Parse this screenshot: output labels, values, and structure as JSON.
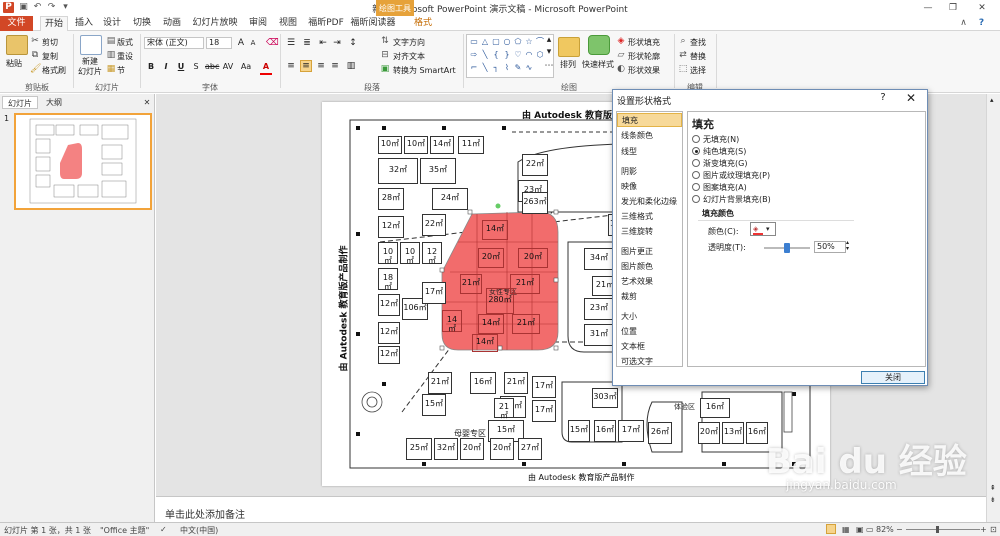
{
  "window": {
    "title": "新建 Microsoft PowerPoint 演示文稿 - Microsoft PowerPoint",
    "contextual_tab_group": "绘图工具",
    "accent": "#d24726",
    "contextual_color": "#e6a23a"
  },
  "tabs": [
    "文件",
    "开始",
    "插入",
    "设计",
    "切换",
    "动画",
    "幻灯片放映",
    "审阅",
    "视图",
    "福昕PDF",
    "福昕阅读器",
    "格式"
  ],
  "ribbon": {
    "clipboard": {
      "label": "剪贴板",
      "paste": "粘贴",
      "cut": "剪切",
      "copy": "复制",
      "format_painter": "格式刷"
    },
    "slides": {
      "label": "幻灯片",
      "new_slide": "新建\n幻灯片",
      "layout": "版式",
      "reset": "重设",
      "section": "节"
    },
    "font": {
      "label": "字体",
      "font_name": "宋体 (正文)",
      "font_size": "18"
    },
    "paragraph": {
      "label": "段落",
      "text_direction": "文字方向",
      "align_text": "对齐文本",
      "smartart": "转换为 SmartArt"
    },
    "drawing": {
      "label": "绘图",
      "arrange": "排列",
      "quick_styles": "快速样式",
      "shape_fill": "形状填充",
      "shape_outline": "形状轮廓",
      "shape_effects": "形状效果"
    },
    "editing": {
      "label": "编辑",
      "find": "查找",
      "replace": "替换",
      "select": "选择"
    }
  },
  "left_panel": {
    "tabs": [
      "幻灯片",
      "大纲"
    ],
    "slide_number": "1"
  },
  "slide": {
    "top_label": "由 Autodesk 教育版产品制作",
    "side_label": "由 Autodesk 教育版产品制作",
    "bottom_label": "由 Autodesk 教育版产品制作",
    "highlight_color": "#f26c6c",
    "zone_labels": [
      "母婴专区",
      "女性专区",
      "体验区"
    ],
    "cells": [
      "10㎡",
      "10㎡",
      "14㎡",
      "11㎡",
      "32㎡",
      "35㎡",
      "22㎡",
      "28㎡",
      "24㎡",
      "23㎡",
      "12㎡",
      "22㎡",
      "14㎡",
      "34㎡",
      "10㎡",
      "10㎡",
      "12㎡",
      "20㎡",
      "20㎡",
      "21㎡",
      "18㎡",
      "21㎡",
      "21㎡",
      "12㎡",
      "106㎡",
      "280㎡",
      "23㎡",
      "17㎡",
      "12㎡",
      "14㎡",
      "14㎡",
      "21㎡",
      "31㎡",
      "12㎡",
      "14㎡",
      "21㎡",
      "16㎡",
      "21㎡",
      "17㎡",
      "15㎡",
      "15㎡",
      "17㎡",
      "15㎡",
      "303㎡",
      "25㎡",
      "32㎡",
      "20㎡",
      "20㎡",
      "27㎡",
      "15㎡",
      "16㎡",
      "17㎡",
      "26㎡",
      "20㎡",
      "13㎡",
      "16㎡",
      "16㎡",
      "263㎡",
      "19㎡",
      "21㎡",
      "17㎡"
    ]
  },
  "notes_placeholder": "单击此处添加备注",
  "status": {
    "slide_info": "幻灯片 第 1 张，共 1 张",
    "theme": "\"Office 主题\"",
    "language": "中文(中国)",
    "zoom": "82%"
  },
  "dialog": {
    "title": "设置形状格式",
    "help": "?",
    "close": "✕",
    "nav": [
      "填充",
      "线条颜色",
      "线型",
      "阴影",
      "映像",
      "发光和柔化边缘",
      "三维格式",
      "三维旋转",
      "图片更正",
      "图片颜色",
      "艺术效果",
      "裁剪",
      "大小",
      "位置",
      "文本框",
      "可选文字"
    ],
    "panel_title": "填充",
    "options": [
      "无填充(N)",
      "纯色填充(S)",
      "渐变填充(G)",
      "图片或纹理填充(P)",
      "图案填充(A)",
      "幻灯片背景填充(B)"
    ],
    "selected_option": 1,
    "fill_color_heading": "填充颜色",
    "color_label": "颜色(C):",
    "transparency_label": "透明度(T):",
    "transparency_value": "50%",
    "transparency": 0.5,
    "close_button": "关闭"
  },
  "watermark": {
    "logo": "Bai du 经验",
    "url": "jingyan.baidu.com"
  }
}
